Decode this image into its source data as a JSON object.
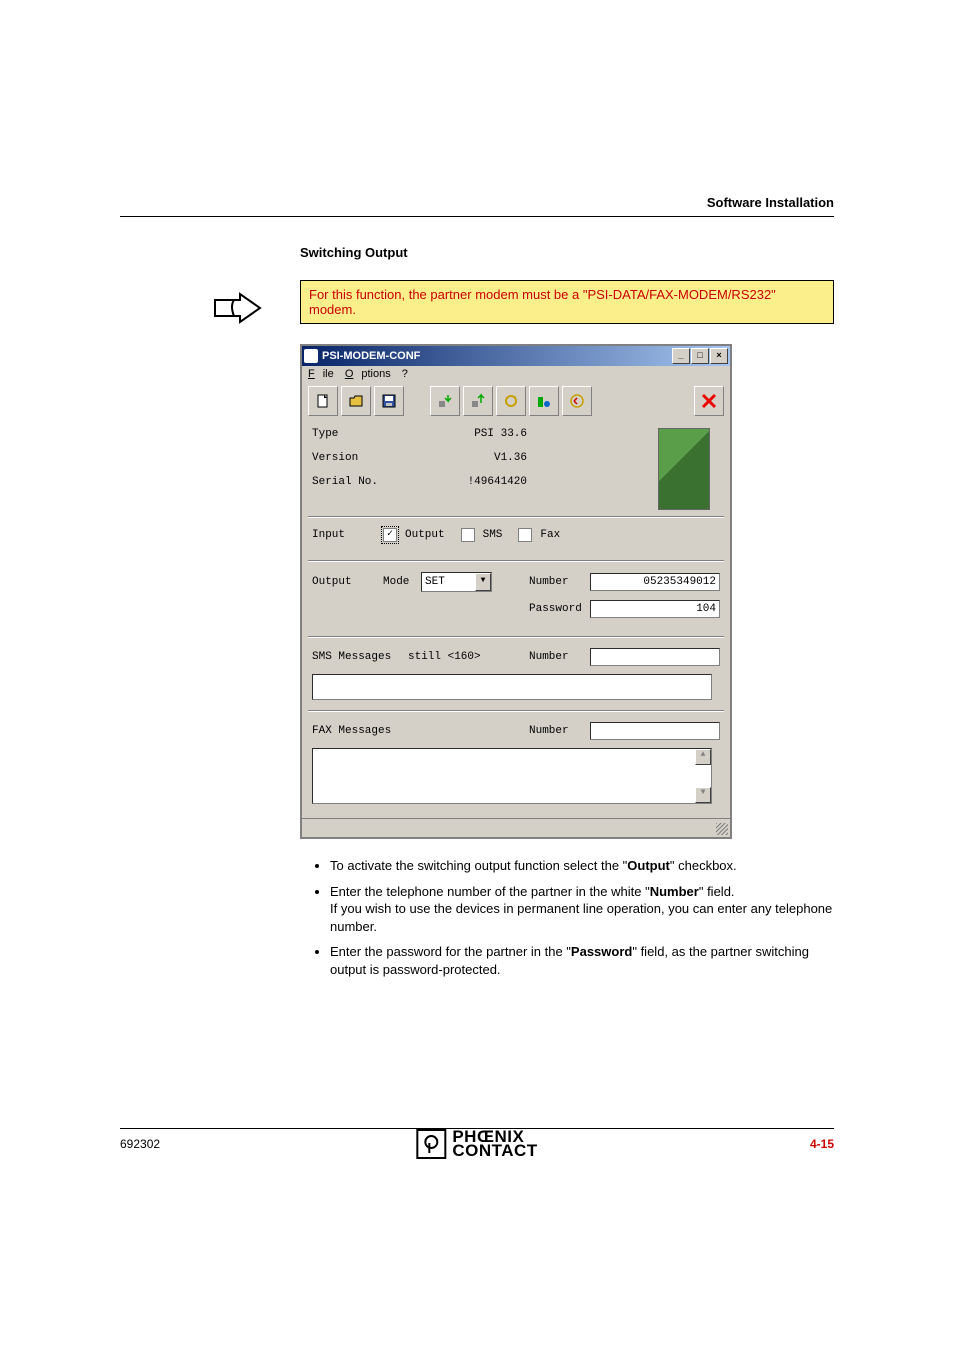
{
  "header": {
    "breadcrumb": "Software Installation"
  },
  "section": {
    "title": "Switching Output"
  },
  "note": {
    "text": "For this function, the partner modem must be a \"PSI-DATA/FAX-MODEM/RS232\" modem."
  },
  "window": {
    "title": "PSI-MODEM-CONF",
    "menu": {
      "file": "File",
      "options": "Options",
      "help": "?"
    },
    "info": {
      "type_label": "Type",
      "type_value": "PSI 33.6",
      "version_label": "Version",
      "version_value": "V1.36",
      "serial_label": "Serial No.",
      "serial_value": "!49641420"
    },
    "input": {
      "label": "Input",
      "output_chk": "Output",
      "sms_chk": "SMS",
      "fax_chk": "Fax"
    },
    "output": {
      "label": "Output",
      "mode_label": "Mode",
      "mode_value": "SET",
      "number_label": "Number",
      "number_value": "05235349012",
      "password_label": "Password",
      "password_value": "104"
    },
    "sms": {
      "label": "SMS Messages",
      "remaining": "still <160>",
      "number_label": "Number",
      "number_value": ""
    },
    "fax": {
      "label": "FAX Messages",
      "number_label": "Number",
      "number_value": ""
    }
  },
  "bullets": {
    "b1a": "To activate the switching output function select the \"",
    "b1b": "Output",
    "b1c": "\" checkbox.",
    "b2a": "Enter the telephone number of the partner in the white \"",
    "b2b": "Number",
    "b2c": "\" field.",
    "b2d": "If you wish to use the devices in permanent line operation, you can enter any telephone number.",
    "b3a": "Enter the password for the partner in the \"",
    "b3b": "Password",
    "b3c": "\" field, as the partner switching output is password-protected."
  },
  "footer": {
    "doc_id": "692302",
    "brand_line1": "PHŒNIX",
    "brand_line2": "CONTACT",
    "page": "4-15"
  }
}
